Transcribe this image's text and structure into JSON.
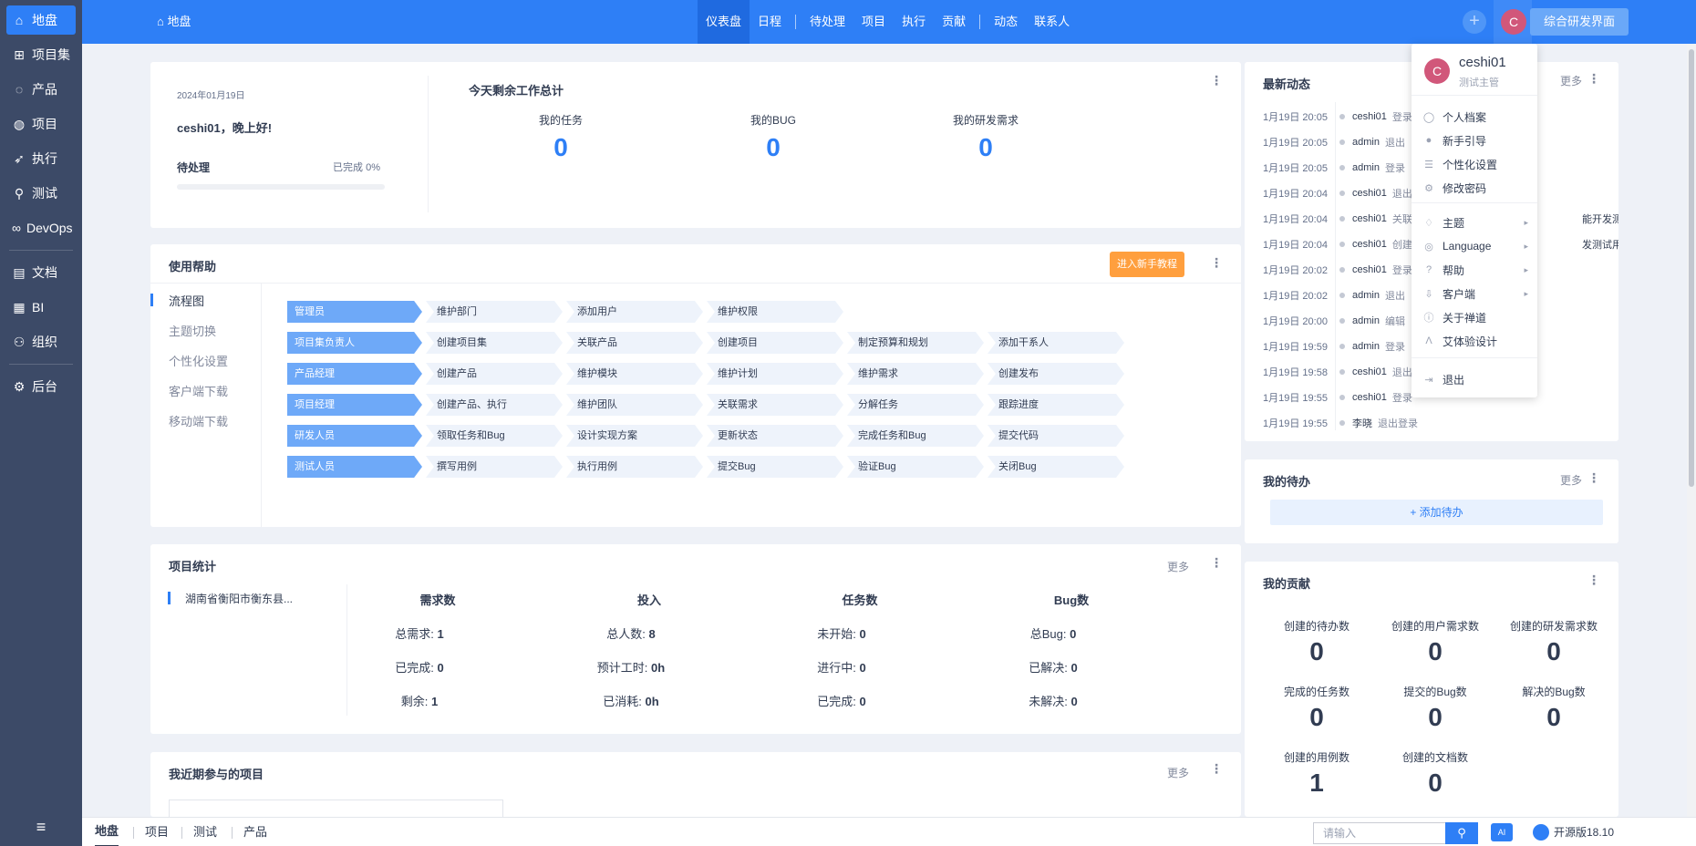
{
  "sidebar": {
    "items": [
      {
        "label": "地盘",
        "icon": "home-icon",
        "glyph": "⌂"
      },
      {
        "label": "项目集",
        "icon": "grid-icon",
        "glyph": "⊞"
      },
      {
        "label": "产品",
        "icon": "lightbulb-icon",
        "glyph": "◌"
      },
      {
        "label": "项目",
        "icon": "rocket-icon",
        "glyph": "◍"
      },
      {
        "label": "执行",
        "icon": "run-icon",
        "glyph": "➶"
      },
      {
        "label": "测试",
        "icon": "magnifier-icon",
        "glyph": "⚲"
      },
      {
        "label": "DevOps",
        "icon": "infinity-icon",
        "glyph": "∞"
      },
      {
        "label": "文档",
        "icon": "document-icon",
        "glyph": "▤"
      },
      {
        "label": "BI",
        "icon": "chart-icon",
        "glyph": "▦"
      },
      {
        "label": "组织",
        "icon": "users-icon",
        "glyph": "⚇"
      },
      {
        "label": "后台",
        "icon": "gear-icon",
        "glyph": "⚙"
      }
    ],
    "collapse_glyph": "≡"
  },
  "topbar": {
    "breadcrumb": "地盘",
    "nav": [
      "仪表盘",
      "日程",
      "待处理",
      "项目",
      "执行",
      "贡献",
      "动态",
      "联系人"
    ],
    "avatar_letter": "C",
    "switch_label": "综合研发界面"
  },
  "welcome": {
    "date": "2024年01月19日",
    "greeting": "ceshi01，晚上好!",
    "pending_label": "待处理",
    "done_label": "已完成 0%",
    "progress": 0
  },
  "today": {
    "title": "今天剩余工作总计",
    "items": [
      {
        "label": "我的任务",
        "value": "0"
      },
      {
        "label": "我的BUG",
        "value": "0"
      },
      {
        "label": "我的研发需求",
        "value": "0"
      }
    ]
  },
  "help": {
    "title": "使用帮助",
    "tutorial_button": "进入新手教程",
    "tabs": [
      "流程图",
      "主题切换",
      "个性化设置",
      "客户端下载",
      "移动端下载"
    ],
    "flows": [
      {
        "role": "管理员",
        "steps": [
          "维护部门",
          "添加用户",
          "维护权限"
        ]
      },
      {
        "role": "项目集负责人",
        "steps": [
          "创建项目集",
          "关联产品",
          "创建项目",
          "制定预算和规划",
          "添加干系人"
        ]
      },
      {
        "role": "产品经理",
        "steps": [
          "创建产品",
          "维护模块",
          "维护计划",
          "维护需求",
          "创建发布"
        ]
      },
      {
        "role": "项目经理",
        "steps": [
          "创建产品、执行",
          "维护团队",
          "关联需求",
          "分解任务",
          "跟踪进度"
        ]
      },
      {
        "role": "研发人员",
        "steps": [
          "领取任务和Bug",
          "设计实现方案",
          "更新状态",
          "完成任务和Bug",
          "提交代码"
        ]
      },
      {
        "role": "测试人员",
        "steps": [
          "撰写用例",
          "执行用例",
          "提交Bug",
          "验证Bug",
          "关闭Bug"
        ]
      }
    ]
  },
  "project_stats": {
    "title": "项目统计",
    "more": "更多",
    "project_name": "湖南省衡阳市衡东县...",
    "columns": [
      {
        "head": "需求数",
        "rows": [
          {
            "k": "总需求:",
            "v": "1"
          },
          {
            "k": "已完成:",
            "v": "0"
          },
          {
            "k": "剩余:",
            "v": "1"
          }
        ]
      },
      {
        "head": "投入",
        "rows": [
          {
            "k": "总人数:",
            "v": "8"
          },
          {
            "k": "预计工时:",
            "v": "0h"
          },
          {
            "k": "已消耗:",
            "v": "0h"
          }
        ]
      },
      {
        "head": "任务数",
        "rows": [
          {
            "k": "未开始:",
            "v": "0"
          },
          {
            "k": "进行中:",
            "v": "0"
          },
          {
            "k": "已完成:",
            "v": "0"
          }
        ]
      },
      {
        "head": "Bug数",
        "rows": [
          {
            "k": "总Bug:",
            "v": "0"
          },
          {
            "k": "已解决:",
            "v": "0"
          },
          {
            "k": "未解决:",
            "v": "0"
          }
        ]
      }
    ]
  },
  "recent_projects": {
    "title": "我近期参与的项目",
    "more": "更多"
  },
  "activity": {
    "title": "最新动态",
    "more": "更多",
    "rows": [
      {
        "time": "1月19日 20:05",
        "user": "ceshi01",
        "text": "登录"
      },
      {
        "time": "1月19日 20:05",
        "user": "admin",
        "text": "退出"
      },
      {
        "time": "1月19日 20:05",
        "user": "admin",
        "text": "登录"
      },
      {
        "time": "1月19日 20:04",
        "user": "ceshi01",
        "text": "退出"
      },
      {
        "time": "1月19日 20:04",
        "user": "ceshi01",
        "text": "关联",
        "tail": "能开发测试"
      },
      {
        "time": "1月19日 20:04",
        "user": "ceshi01",
        "text": "创建",
        "tail": "发测试用例"
      },
      {
        "time": "1月19日 20:02",
        "user": "ceshi01",
        "text": "登录"
      },
      {
        "time": "1月19日 20:02",
        "user": "admin",
        "text": "退出"
      },
      {
        "time": "1月19日 20:00",
        "user": "admin",
        "text": "编辑"
      },
      {
        "time": "1月19日 19:59",
        "user": "admin",
        "text": "登录"
      },
      {
        "time": "1月19日 19:58",
        "user": "ceshi01",
        "text": "退出"
      },
      {
        "time": "1月19日 19:55",
        "user": "ceshi01",
        "text": "登录"
      },
      {
        "time": "1月19日 19:55",
        "user": "李晓",
        "text": "退出登录"
      }
    ]
  },
  "todo": {
    "title": "我的待办",
    "more": "更多",
    "add_label": "+ 添加待办"
  },
  "contribution": {
    "title": "我的贡献",
    "items": [
      {
        "label": "创建的待办数",
        "value": "0"
      },
      {
        "label": "创建的用户需求数",
        "value": "0"
      },
      {
        "label": "创建的研发需求数",
        "value": "0"
      },
      {
        "label": "完成的任务数",
        "value": "0"
      },
      {
        "label": "提交的Bug数",
        "value": "0"
      },
      {
        "label": "解决的Bug数",
        "value": "0"
      },
      {
        "label": "创建的用例数",
        "value": "1"
      },
      {
        "label": "创建的文档数",
        "value": "0"
      }
    ]
  },
  "user_menu": {
    "name": "ceshi01",
    "role": "测试主管",
    "items": [
      {
        "label": "个人档案",
        "icon": "user-icon",
        "glyph": "◯"
      },
      {
        "label": "新手引导",
        "icon": "pin-icon",
        "glyph": "●"
      },
      {
        "label": "个性化设置",
        "icon": "sliders-icon",
        "glyph": "☰"
      },
      {
        "label": "修改密码",
        "icon": "gear-icon",
        "glyph": "⚙"
      },
      {
        "label": "主题",
        "icon": "shirt-icon",
        "glyph": "♢",
        "sub": true
      },
      {
        "label": "Language",
        "icon": "globe-icon",
        "glyph": "◎",
        "sub": true
      },
      {
        "label": "帮助",
        "icon": "help-icon",
        "glyph": "?",
        "sub": true
      },
      {
        "label": "客户端",
        "icon": "download-icon",
        "glyph": "⇩",
        "sub": true
      },
      {
        "label": "关于禅道",
        "icon": "info-icon",
        "glyph": "ⓘ"
      },
      {
        "label": "艾体验设计",
        "icon": "logo-a-icon",
        "glyph": "Λ"
      },
      {
        "label": "退出",
        "icon": "logout-icon",
        "glyph": "⇥"
      }
    ]
  },
  "bottombar": {
    "links": [
      "地盘",
      "项目",
      "测试",
      "产品"
    ],
    "search_placeholder": "请输入",
    "version": "开源版18.10"
  }
}
